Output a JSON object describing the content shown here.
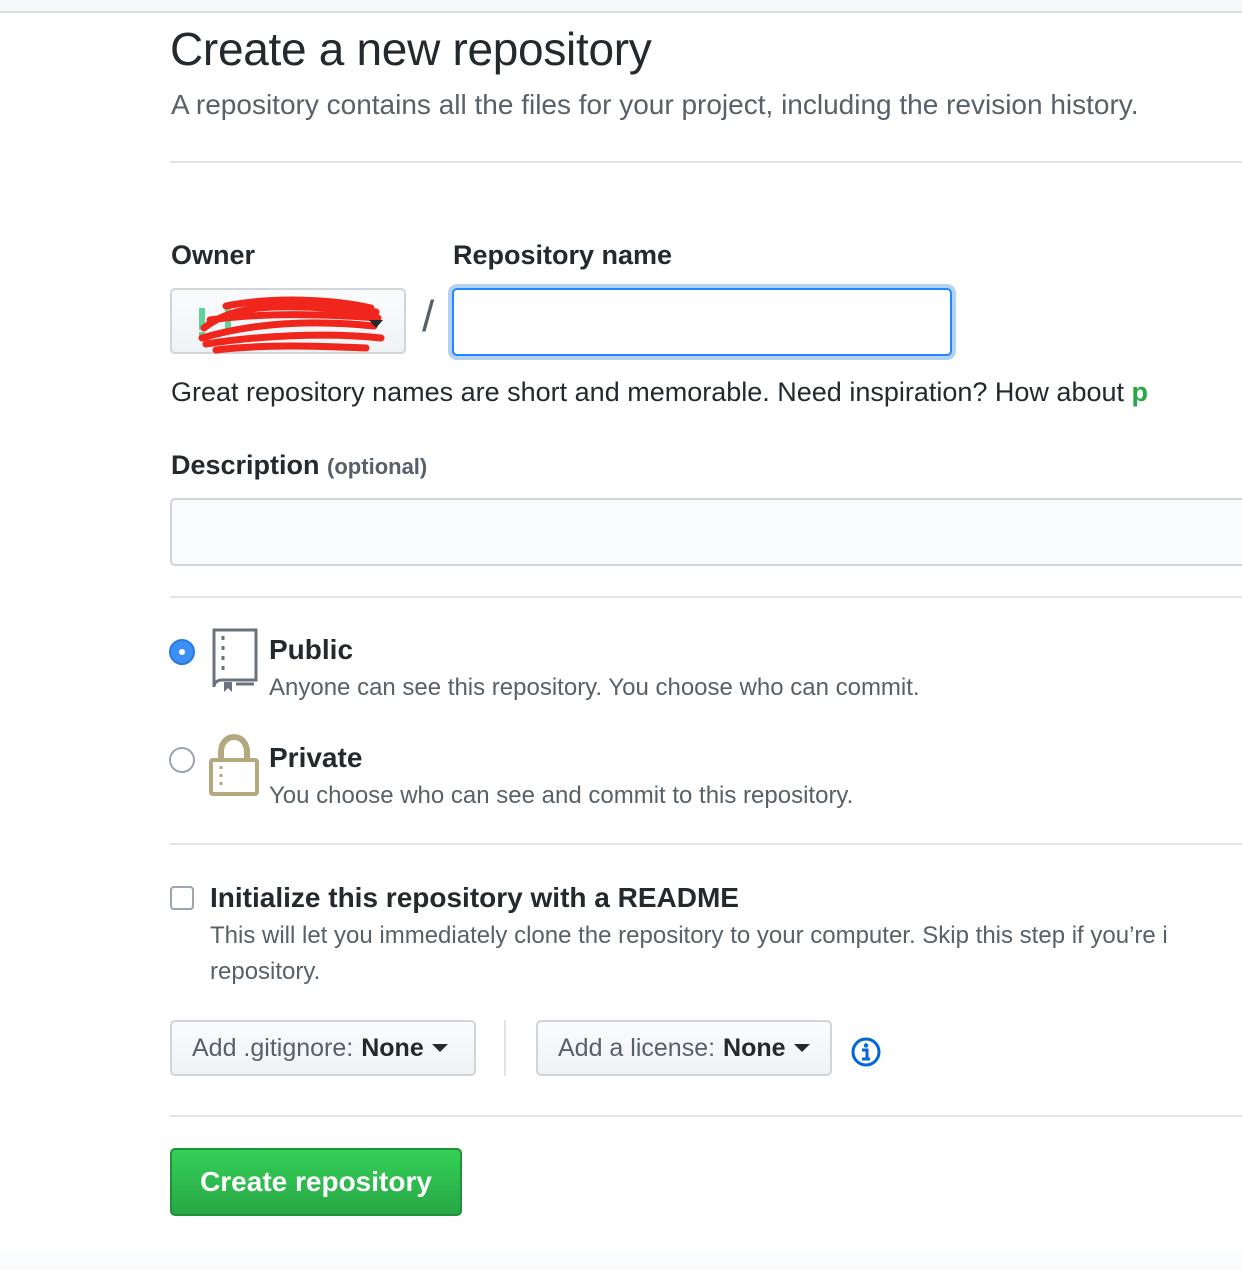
{
  "header": {
    "title": "Create a new repository",
    "subtitle": "A repository contains all the files for your project, including the revision history."
  },
  "owner": {
    "label": "Owner",
    "value": ""
  },
  "repo": {
    "label": "Repository name",
    "value": "",
    "separator": "/"
  },
  "hint": {
    "text": "Great repository names are short and memorable. Need inspiration? How about ",
    "suggestion": "p"
  },
  "description": {
    "label": "Description",
    "optional": "(optional)",
    "value": ""
  },
  "visibility": {
    "selected": "public",
    "public_title": "Public",
    "public_desc": "Anyone can see this repository. You choose who can commit.",
    "private_title": "Private",
    "private_desc": "You choose who can see and commit to this repository."
  },
  "readme": {
    "checked": false,
    "title": "Initialize this repository with a README",
    "desc_line1": "This will let you immediately clone the repository to your computer. Skip this step if you’re i",
    "desc_line2": "repository."
  },
  "gitignore": {
    "label": "Add .gitignore:",
    "value": "None"
  },
  "license": {
    "label": "Add a license:",
    "value": "None"
  },
  "info_icon": "info-icon",
  "submit": {
    "label": "Create repository"
  },
  "colors": {
    "accent_blue": "#2188ff",
    "green": "#28a745",
    "text": "#24292e",
    "muted": "#586069"
  }
}
